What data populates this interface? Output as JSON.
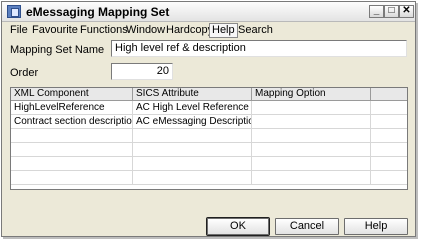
{
  "window": {
    "title": "eMessaging Mapping Set"
  },
  "menu": [
    "File",
    "Favourite",
    "Functions",
    "Window",
    "Hardcopy",
    "Help",
    "Search"
  ],
  "form": {
    "mapping_set_name_label": "Mapping Set Name",
    "mapping_set_name_value": "High level ref & description",
    "order_label": "Order",
    "order_value": "20"
  },
  "grid": {
    "columns": [
      "XML Component",
      "SICS Attribute",
      "Mapping Option"
    ],
    "rows": [
      [
        "HighLevelReference",
        "AC High Level Reference",
        ""
      ],
      [
        "Contract section description",
        "AC eMessaging Description",
        ""
      ]
    ]
  },
  "buttons": {
    "ok": "OK",
    "cancel": "Cancel",
    "help": "Help"
  }
}
